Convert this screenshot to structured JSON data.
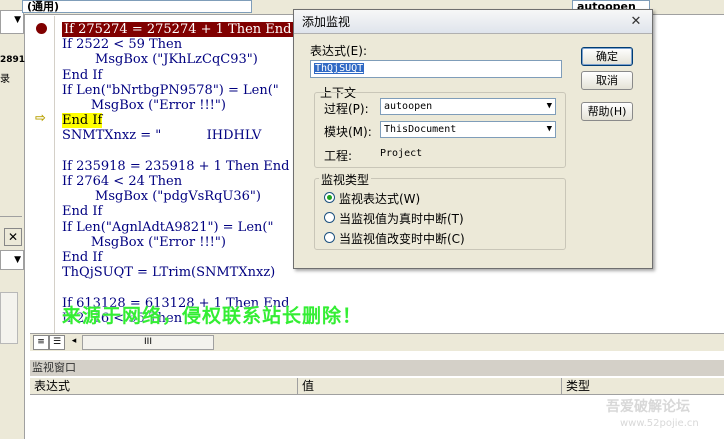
{
  "editor": {
    "proc_combo": "(通用)",
    "proc_right": "autoopen",
    "lines": [
      {
        "text": "If 275274 = 275274 + 1 Then End",
        "style": "breakpoint"
      },
      {
        "text": "If 2522 < 59 Then",
        "style": ""
      },
      {
        "text": "        MsgBox (\"JKhLzCqC93\")",
        "style": ""
      },
      {
        "text": "End If",
        "style": ""
      },
      {
        "text": "If Len(\"bNrtbgPN9578\") = Len(\"",
        "style": ""
      },
      {
        "text": "       MsgBox (\"Error !!!\")",
        "style": ""
      },
      {
        "text": "End If",
        "style": "current"
      },
      {
        "text": "SNMTXnxz = \"           IHDHLV",
        "style": ""
      },
      {
        "text": "",
        "style": ""
      },
      {
        "text": "If 235918 = 235918 + 1 Then End",
        "style": ""
      },
      {
        "text": "If 2764 < 24 Then",
        "style": ""
      },
      {
        "text": "        MsgBox (\"pdgVsRqU36\")",
        "style": ""
      },
      {
        "text": "End If",
        "style": ""
      },
      {
        "text": "If Len(\"AgnlAdtA9821\") = Len(\"",
        "style": ""
      },
      {
        "text": "       MsgBox (\"Error !!!\")",
        "style": ""
      },
      {
        "text": "End If",
        "style": ""
      },
      {
        "text": "ThQjSUQT = LTrim(SNMTXnxz)",
        "style": ""
      },
      {
        "text": "",
        "style": ""
      },
      {
        "text": "If 613128 = 613128 + 1 Then End",
        "style": ""
      },
      {
        "text": "If 2116 < 55 Then",
        "style": ""
      }
    ],
    "hscroll_label": "III"
  },
  "sidebar": {
    "num_fragment": "2891",
    "char_fragment": "录"
  },
  "watch_window": {
    "title": "监视窗口",
    "columns": [
      "表达式",
      "值",
      "类型"
    ]
  },
  "dialog": {
    "title": "添加监视",
    "expression_label": "表达式(E):",
    "expression_value": "ThQjSUQT",
    "context_label": "上下文",
    "procedure_label": "过程(P):",
    "procedure_value": "autoopen",
    "module_label": "模块(M):",
    "module_value": "ThisDocument",
    "project_label": "工程:",
    "project_value": "Project",
    "watch_type_label": "监视类型",
    "options": [
      {
        "label": "监视表达式(W)",
        "selected": true
      },
      {
        "label": "当监视值为真时中断(T)",
        "selected": false
      },
      {
        "label": "当监视值改变时中断(C)",
        "selected": false
      }
    ],
    "buttons": {
      "ok": "确定",
      "cancel": "取消",
      "help": "帮助(H)"
    }
  },
  "overlay": {
    "watermark": "来源于网络，侵权联系站长删除！",
    "site_logo": "吾爱破解论坛",
    "site_url": "www.52pojie.cn"
  }
}
